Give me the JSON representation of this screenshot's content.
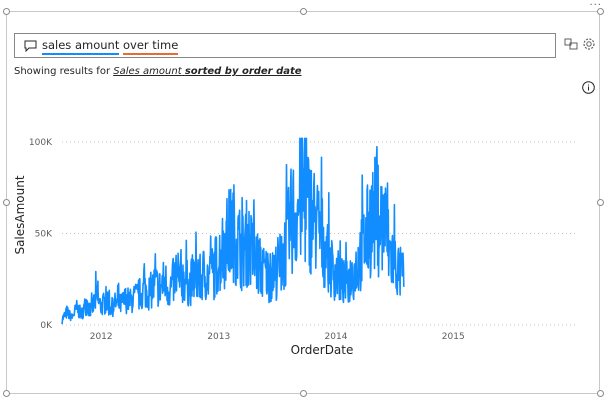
{
  "toolbar": {
    "more_label": "···"
  },
  "qa": {
    "question_words": [
      "sales amount",
      "over time"
    ],
    "showing_prefix": "Showing results for",
    "showing_italic": "Sales amount",
    "showing_bold": "sorted by order date"
  },
  "icons": {
    "question": "chat-bubble-icon",
    "related": "related-visuals-icon",
    "settings": "gear-icon",
    "info": "info-icon"
  },
  "colors": {
    "series": "#118dff",
    "accent_underline_1": "#118dff",
    "accent_underline_2": "#e66c37"
  },
  "chart_data": {
    "type": "line",
    "title": "",
    "xlabel": "OrderDate",
    "ylabel": "SalesAmount",
    "x_ticks": [
      "2012",
      "2013",
      "2014",
      "2015"
    ],
    "y_ticks": [
      "0K",
      "50K",
      "100K"
    ],
    "x_range": [
      "2011-09-01",
      "2016-01-15"
    ],
    "ylim": [
      0,
      100000
    ],
    "grid": "horizontal-dotted",
    "series": [
      {
        "color": "#118dff",
        "x_start": "2011-09-01",
        "x_step": "half-month",
        "values": [
          3000,
          7000,
          4000,
          9000,
          6000,
          12000,
          8000,
          15000,
          10000,
          13000,
          9000,
          12000,
          11000,
          14000,
          13000,
          15000,
          17000,
          19000,
          18000,
          22000,
          20000,
          24000,
          19000,
          25000,
          22000,
          26000,
          21000,
          27000,
          24000,
          28000,
          26000,
          30000,
          35000,
          42000,
          48000,
          52000,
          45000,
          40000,
          46000,
          38000,
          34000,
          29000,
          28000,
          26000,
          31000,
          35000,
          45000,
          58000,
          62000,
          70000,
          65000,
          60000,
          55000,
          48000,
          40000,
          32000,
          28000,
          25000,
          22000,
          26000,
          30000,
          38000,
          45000,
          55000,
          60000,
          58000,
          52000,
          40000,
          35000,
          28000,
          27000
        ]
      }
    ]
  }
}
